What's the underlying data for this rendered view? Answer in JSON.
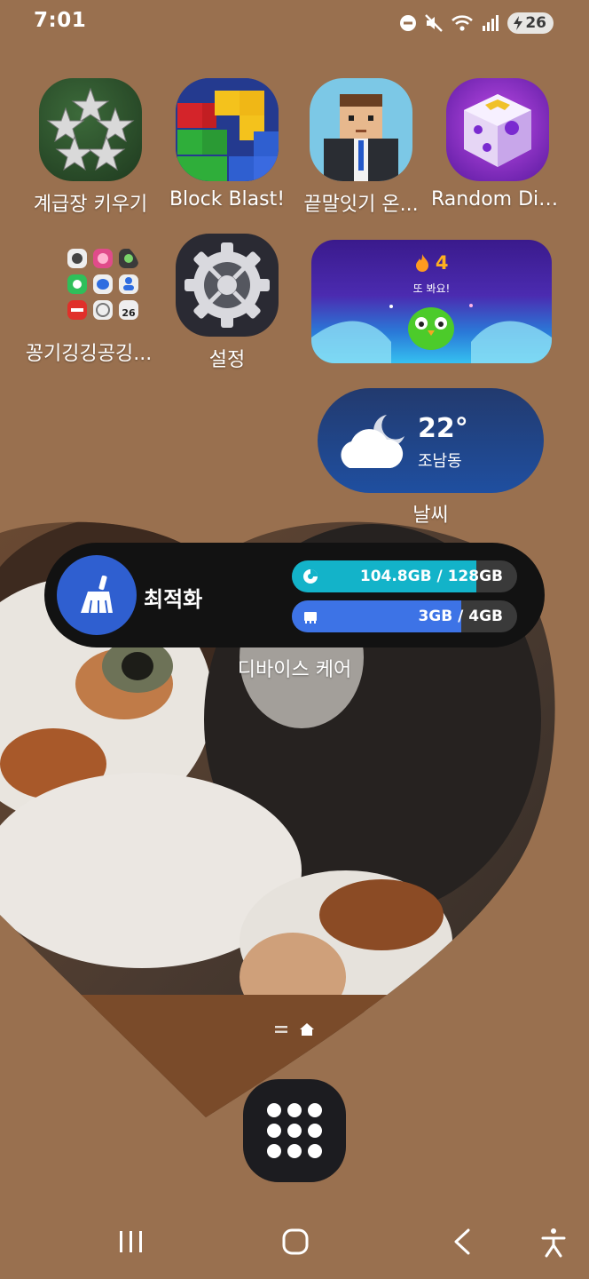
{
  "status_bar": {
    "time": "7:01",
    "battery": "26",
    "icons": [
      "dnd-icon",
      "mute-icon",
      "wifi-icon",
      "signal-icon",
      "battery-charging-icon"
    ]
  },
  "apps_row1": [
    {
      "label": "계급장 키우기",
      "icon": "stars-rank-icon"
    },
    {
      "label": "Block Blast!",
      "icon": "block-blast-icon"
    },
    {
      "label": "끝말잇기 온...",
      "icon": "word-chain-icon"
    },
    {
      "label": "Random Dic...",
      "icon": "random-dice-icon"
    }
  ],
  "apps_row2": [
    {
      "label": "꽁기깅깅공깅...",
      "icon": "folder-icon"
    },
    {
      "label": "설정",
      "icon": "settings-gear-icon"
    }
  ],
  "folder_mini_date": "26",
  "duolingo": {
    "streak": "4",
    "subtitle": "또 봐요!"
  },
  "weather": {
    "temperature": "22°",
    "location": "조남동",
    "label": "날씨",
    "icon": "cloud-moon-icon"
  },
  "device_care": {
    "optimize_label": "최적화",
    "storage_text": "104.8GB / 128GB",
    "storage_fraction": 0.82,
    "memory_text": "3GB / 4GB",
    "memory_fraction": 0.75,
    "label": "디바이스 케어",
    "colors": {
      "storage": "#13b3c9",
      "memory": "#3d73e6",
      "button": "#2f5fd0"
    }
  },
  "page_indicator": {
    "icons": [
      "pages-list-icon",
      "home-page-icon"
    ]
  },
  "nav_bar": {
    "icons": [
      "recents-icon",
      "home-icon",
      "back-icon",
      "accessibility-icon"
    ]
  }
}
